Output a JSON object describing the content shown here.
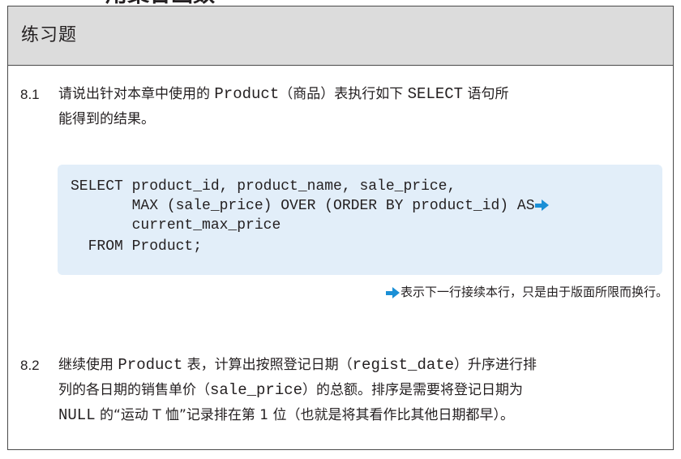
{
  "top_fragment": "用聚合函数",
  "header": {
    "title": "练习题"
  },
  "q1": {
    "number": "8.1",
    "line1_pre": "请说出针对本章中使用的 ",
    "line1_code": "Product",
    "line1_post": "（商品）表执行如下 ",
    "line1_code2": "SELECT",
    "line1_tail": " 语句所",
    "line2": "能得到的结果。"
  },
  "code": {
    "line1": "SELECT product_id, product_name, sale_price,",
    "line2": "       MAX (sale_price) OVER (ORDER BY product_id) AS",
    "line3": "       current_max_price",
    "line4": "  FROM Product;"
  },
  "note": {
    "text": "表示下一行接续本行，只是由于版面所限而换行。"
  },
  "q2": {
    "number": "8.2",
    "line1_pre": "继续使用 ",
    "line1_code": "Product",
    "line1_mid": " 表，计算出按照登记日期（",
    "line1_code2": "regist_date",
    "line1_tail": "）升序进行排",
    "line2_pre": "列的各日期的销售单价（",
    "line2_code": "sale_price",
    "line2_tail": "）的总额。排序是需要将登记日期为",
    "line3_code": "NULL",
    "line3_tail": " 的“运动 T 恤”记录排在第 1 位（也就是将其看作比其他日期都早）。"
  },
  "colors": {
    "header_bg": "#dcdcdc",
    "code_bg": "#e2eef9",
    "arrow": "#1a8fd6",
    "text": "#231f20"
  },
  "icons": {
    "continuation": "right-arrow-icon"
  }
}
